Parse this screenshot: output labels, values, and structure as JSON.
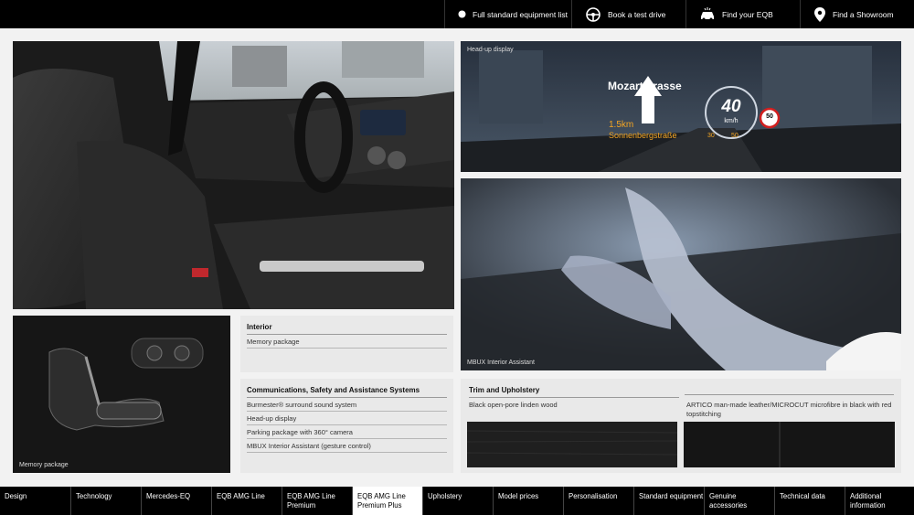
{
  "top_nav": [
    {
      "label": "Full standard equipment list",
      "icon": "dot-icon"
    },
    {
      "label": "Book a test drive",
      "icon": "steering-wheel-icon"
    },
    {
      "label": "Find your EQB",
      "icon": "car-icon"
    },
    {
      "label": "Find a Showroom",
      "icon": "location-pin-icon"
    }
  ],
  "captions": {
    "hud": "Head-up display",
    "mbux": "MBUX Interior Assistant",
    "memory": "Memory package"
  },
  "hud": {
    "street": "Mozartstrasse",
    "distance": "1.5km",
    "next_street": "Sonnenbergstraße",
    "speed": "40",
    "speed_unit": "km/h",
    "scale_low": "30",
    "scale_high": "50",
    "limit": "50"
  },
  "interior": {
    "title": "Interior",
    "items": [
      "Memory package"
    ]
  },
  "comms": {
    "title": "Communications, Safety and Assistance Systems",
    "items": [
      "Burmester® surround sound system",
      "Head-up display",
      "Parking package with 360° camera",
      "MBUX Interior Assistant (gesture control)"
    ]
  },
  "trim": {
    "title": "Trim and Upholstery",
    "items": [
      "Black open-pore linden wood",
      "ARTICO man-made leather/MICROCUT microfibre in black with red topstitching"
    ]
  },
  "bottom_nav": [
    {
      "label": "Design",
      "active": false
    },
    {
      "label": "Technology",
      "active": false
    },
    {
      "label": "Mercedes-EQ",
      "active": false
    },
    {
      "label": "EQB AMG Line",
      "active": false
    },
    {
      "label": "EQB AMG Line Premium",
      "active": false
    },
    {
      "label": "EQB AMG Line Premium Plus",
      "active": true
    },
    {
      "label": "Upholstery",
      "active": false
    },
    {
      "label": "Model prices",
      "active": false
    },
    {
      "label": "Personalisation",
      "active": false
    },
    {
      "label": "Standard equipment",
      "active": false
    },
    {
      "label": "Genuine accessories",
      "active": false
    },
    {
      "label": "Technical data",
      "active": false
    },
    {
      "label": "Additional information",
      "active": false
    }
  ],
  "colors": {
    "accent": "#f5a623",
    "bar": "#000000",
    "panel": "#e9e9e9"
  }
}
